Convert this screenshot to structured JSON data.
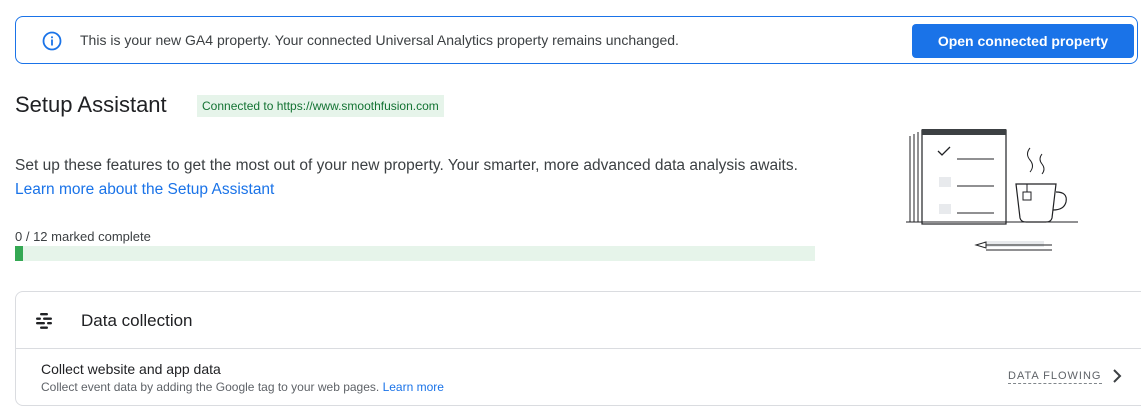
{
  "banner": {
    "message": "This is your new GA4 property. Your connected Universal Analytics property remains unchanged.",
    "button_label": "Open connected property",
    "icon": "info-icon"
  },
  "setup": {
    "title": "Setup Assistant",
    "connected_badge": "Connected to https://www.smoothfusion.com",
    "description": "Set up these features to get the most out of your new property. Your smarter, more advanced data analysis awaits.",
    "learn_more_link": "Learn more about the Setup Assistant",
    "progress_label": "0 / 12 marked complete",
    "progress_fraction": 0.01
  },
  "data_collection": {
    "title": "Data collection",
    "icon": "data-collection-icon",
    "task": {
      "title": "Collect website and app data",
      "description": "Collect event data by adding the Google tag to your web pages.",
      "learn_more": "Learn more",
      "status": "DATA FLOWING"
    }
  },
  "colors": {
    "accent": "#1a73e8",
    "progress_fill": "#34a853",
    "progress_track": "#e6f4ea",
    "badge_bg": "#e6f4ea",
    "badge_text": "#137333"
  }
}
